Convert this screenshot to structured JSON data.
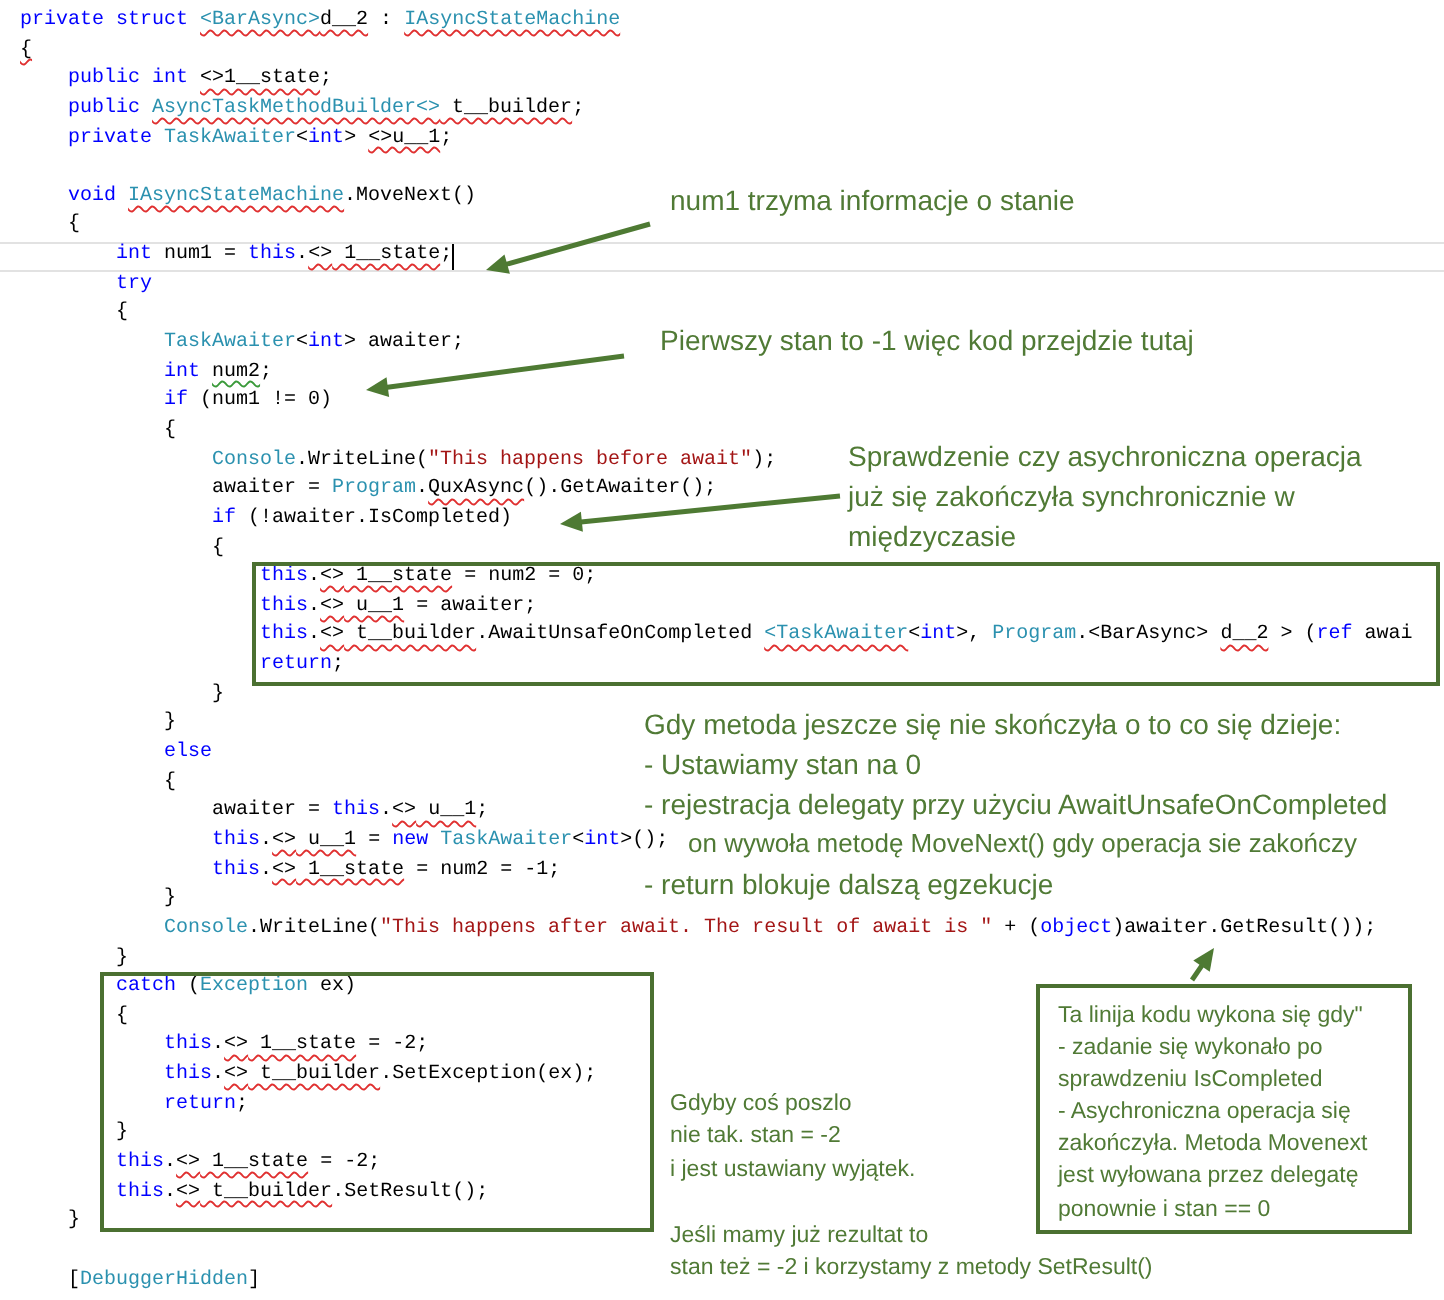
{
  "editor": {
    "lines": [
      {
        "current": false,
        "tokens": [
          {
            "text": "private struct ",
            "kind": "kw"
          },
          {
            "text": "<BarAsync>",
            "kind": "typeerr"
          },
          {
            "text": "d__2",
            "kind": "err"
          },
          {
            "text": " : ",
            "kind": "plain"
          },
          {
            "text": "IAsyncStateMachine",
            "kind": "typeerr"
          }
        ]
      },
      {
        "current": false,
        "tokens": [
          {
            "text": "{",
            "kind": "err"
          }
        ],
        "children": [
          {
            "current": false,
            "tokens": [
              {
                "text": "public int ",
                "kind": "kw"
              },
              {
                "text": "<>1__state",
                "kind": "err"
              },
              {
                "text": ";",
                "kind": "plain"
              }
            ]
          },
          {
            "current": false,
            "tokens": [
              {
                "text": "public ",
                "kind": "kw"
              },
              {
                "text": "AsyncTaskMethodBuilder<>",
                "kind": "typeerr"
              },
              {
                "text": " t__builder",
                "kind": "err"
              },
              {
                "text": ";",
                "kind": "plain"
              }
            ]
          },
          {
            "current": false,
            "tokens": [
              {
                "text": "private ",
                "kind": "kw"
              },
              {
                "text": "TaskAwaiter",
                "kind": "type"
              },
              {
                "text": "<",
                "kind": "plain"
              },
              {
                "text": "int",
                "kind": "kw"
              },
              {
                "text": "> ",
                "kind": "plain"
              },
              {
                "text": "<>u__1",
                "kind": "err"
              },
              {
                "text": ";",
                "kind": "plain"
              }
            ]
          },
          {
            "current": false
          },
          {
            "current": false,
            "tokens": [
              {
                "text": "void ",
                "kind": "kw"
              },
              {
                "text": "IAsyncStateMachine",
                "kind": "typeerr"
              },
              {
                "text": ".MoveNext()",
                "kind": "plain"
              }
            ]
          },
          {
            "current": false,
            "tokens": [
              {
                "text": "{",
                "kind": "plain"
              }
            ],
            "children": [
              {
                "current": true,
                "tokens": [
                  {
                    "text": "int ",
                    "kind": "kw"
                  },
                  {
                    "text": "num1 = ",
                    "kind": "plain"
                  },
                  {
                    "text": "this",
                    "kind": "kw"
                  },
                  {
                    "text": ".",
                    "kind": "plain"
                  },
                  {
                    "text": "<>",
                    "kind": "err"
                  },
                  {
                    "text": " 1__state",
                    "kind": "err"
                  },
                  {
                    "text": ";",
                    "kind": "plain"
                  }
                ]
              },
              {
                "current": false,
                "tokens": [
                  {
                    "text": "try",
                    "kind": "kw"
                  }
                ]
              },
              {
                "current": false,
                "tokens": [
                  {
                    "text": "{",
                    "kind": "plain"
                  }
                ],
                "children": [
                  {
                    "current": false,
                    "tokens": [
                      {
                        "text": "TaskAwaiter",
                        "kind": "type"
                      },
                      {
                        "text": "<",
                        "kind": "plain"
                      },
                      {
                        "text": "int",
                        "kind": "kw"
                      },
                      {
                        "text": "> awaiter;",
                        "kind": "plain"
                      }
                    ]
                  },
                  {
                    "current": false,
                    "tokens": [
                      {
                        "text": "int ",
                        "kind": "kw"
                      },
                      {
                        "text": "num2",
                        "kind": "warn"
                      },
                      {
                        "text": ";",
                        "kind": "plain"
                      }
                    ]
                  },
                  {
                    "current": false,
                    "tokens": [
                      {
                        "text": "if ",
                        "kind": "kw"
                      },
                      {
                        "text": "(num1 != 0)",
                        "kind": "plain"
                      }
                    ]
                  },
                  {
                    "current": false,
                    "tokens": [
                      {
                        "text": "{",
                        "kind": "plain"
                      }
                    ],
                    "children": [
                      {
                        "current": false,
                        "tokens": [
                          {
                            "text": "Console",
                            "kind": "type"
                          },
                          {
                            "text": ".WriteLine(",
                            "kind": "plain"
                          },
                          {
                            "text": "\"This happens before await\"",
                            "kind": "str"
                          },
                          {
                            "text": ");",
                            "kind": "plain"
                          }
                        ]
                      },
                      {
                        "current": false,
                        "tokens": [
                          {
                            "text": "awaiter = ",
                            "kind": "plain"
                          },
                          {
                            "text": "Program",
                            "kind": "type"
                          },
                          {
                            "text": ".",
                            "kind": "plain"
                          },
                          {
                            "text": "QuxAsync",
                            "kind": "err"
                          },
                          {
                            "text": "().GetAwaiter();",
                            "kind": "plain"
                          }
                        ]
                      },
                      {
                        "current": false,
                        "tokens": [
                          {
                            "text": "if ",
                            "kind": "kw"
                          },
                          {
                            "text": "(!awaiter.IsCompleted)",
                            "kind": "plain"
                          }
                        ]
                      },
                      {
                        "current": false,
                        "tokens": [
                          {
                            "text": "{",
                            "kind": "plain"
                          }
                        ],
                        "children": [
                          {
                            "current": false,
                            "tokens": [
                              {
                                "text": "this",
                                "kind": "kw"
                              },
                              {
                                "text": ".",
                                "kind": "plain"
                              },
                              {
                                "text": "<>",
                                "kind": "err"
                              },
                              {
                                "text": " 1__state",
                                "kind": "err"
                              },
                              {
                                "text": " = num2 = 0;",
                                "kind": "plain"
                              }
                            ]
                          },
                          {
                            "current": false,
                            "tokens": [
                              {
                                "text": "this",
                                "kind": "kw"
                              },
                              {
                                "text": ".",
                                "kind": "plain"
                              },
                              {
                                "text": "<>",
                                "kind": "err"
                              },
                              {
                                "text": " u__1",
                                "kind": "err"
                              },
                              {
                                "text": " = awaiter;",
                                "kind": "plain"
                              }
                            ]
                          },
                          {
                            "current": false,
                            "tokens": [
                              {
                                "text": "this",
                                "kind": "kw"
                              },
                              {
                                "text": ".",
                                "kind": "plain"
                              },
                              {
                                "text": "<>",
                                "kind": "err"
                              },
                              {
                                "text": " t__builder",
                                "kind": "err"
                              },
                              {
                                "text": ".AwaitUnsafeOnCompleted ",
                                "kind": "plain"
                              },
                              {
                                "text": "<TaskAwaiter",
                                "kind": "typeerr"
                              },
                              {
                                "text": "<",
                                "kind": "plain"
                              },
                              {
                                "text": "int",
                                "kind": "kw"
                              },
                              {
                                "text": ">, ",
                                "kind": "plain"
                              },
                              {
                                "text": "Program",
                                "kind": "type"
                              },
                              {
                                "text": ".<BarAsync> ",
                                "kind": "plain"
                              },
                              {
                                "text": "d__2",
                                "kind": "err"
                              },
                              {
                                "text": " > (",
                                "kind": "plain"
                              },
                              {
                                "text": "ref",
                                "kind": "kw"
                              },
                              {
                                "text": " awai",
                                "kind": "plain"
                              }
                            ]
                          },
                          {
                            "current": false,
                            "tokens": [
                              {
                                "text": "return",
                                "kind": "kw"
                              },
                              {
                                "text": ";",
                                "kind": "plain"
                              }
                            ]
                          }
                        ]
                      },
                      {
                        "current": false,
                        "tokens": [
                          {
                            "text": "}",
                            "kind": "plain"
                          }
                        ]
                      }
                    ]
                  },
                  {
                    "current": false,
                    "tokens": [
                      {
                        "text": "}",
                        "kind": "plain"
                      }
                    ]
                  },
                  {
                    "current": false,
                    "tokens": [
                      {
                        "text": "else",
                        "kind": "kw"
                      }
                    ]
                  },
                  {
                    "current": false,
                    "tokens": [
                      {
                        "text": "{",
                        "kind": "plain"
                      }
                    ],
                    "children": [
                      {
                        "current": false,
                        "tokens": [
                          {
                            "text": "awaiter = ",
                            "kind": "plain"
                          },
                          {
                            "text": "this",
                            "kind": "kw"
                          },
                          {
                            "text": ".",
                            "kind": "plain"
                          },
                          {
                            "text": "<>",
                            "kind": "err"
                          },
                          {
                            "text": " u__1",
                            "kind": "err"
                          },
                          {
                            "text": ";",
                            "kind": "plain"
                          }
                        ]
                      },
                      {
                        "current": false,
                        "tokens": [
                          {
                            "text": "this",
                            "kind": "kw"
                          },
                          {
                            "text": ".",
                            "kind": "plain"
                          },
                          {
                            "text": "<>",
                            "kind": "err"
                          },
                          {
                            "text": " u__1",
                            "kind": "err"
                          },
                          {
                            "text": " = ",
                            "kind": "plain"
                          },
                          {
                            "text": "new ",
                            "kind": "kw"
                          },
                          {
                            "text": "TaskAwaiter",
                            "kind": "type"
                          },
                          {
                            "text": "<",
                            "kind": "plain"
                          },
                          {
                            "text": "int",
                            "kind": "kw"
                          },
                          {
                            "text": ">();",
                            "kind": "plain"
                          }
                        ]
                      },
                      {
                        "current": false,
                        "tokens": [
                          {
                            "text": "this",
                            "kind": "kw"
                          },
                          {
                            "text": ".",
                            "kind": "plain"
                          },
                          {
                            "text": "<>",
                            "kind": "err"
                          },
                          {
                            "text": " 1__state",
                            "kind": "err"
                          },
                          {
                            "text": " = num2 = -1;",
                            "kind": "plain"
                          }
                        ]
                      }
                    ]
                  },
                  {
                    "current": false,
                    "tokens": [
                      {
                        "text": "}",
                        "kind": "plain"
                      }
                    ]
                  },
                  {
                    "current": false,
                    "tokens": [
                      {
                        "text": "Console",
                        "kind": "type"
                      },
                      {
                        "text": ".WriteLine(",
                        "kind": "plain"
                      },
                      {
                        "text": "\"This happens after await. The result of await is \"",
                        "kind": "str"
                      },
                      {
                        "text": " + (",
                        "kind": "plain"
                      },
                      {
                        "text": "object",
                        "kind": "kw"
                      },
                      {
                        "text": ")awaiter.GetResult());",
                        "kind": "plain"
                      }
                    ]
                  }
                ]
              },
              {
                "current": false,
                "tokens": [
                  {
                    "text": "}",
                    "kind": "plain"
                  }
                ]
              },
              {
                "current": false,
                "tokens": [
                  {
                    "text": "catch ",
                    "kind": "kw"
                  },
                  {
                    "text": "(",
                    "kind": "plain"
                  },
                  {
                    "text": "Exception",
                    "kind": "type"
                  },
                  {
                    "text": " ex)",
                    "kind": "plain"
                  }
                ]
              },
              {
                "current": false,
                "tokens": [
                  {
                    "text": "{",
                    "kind": "plain"
                  }
                ],
                "children": [
                  {
                    "current": false,
                    "tokens": [
                      {
                        "text": "this",
                        "kind": "kw"
                      },
                      {
                        "text": ".",
                        "kind": "plain"
                      },
                      {
                        "text": "<>",
                        "kind": "err"
                      },
                      {
                        "text": " 1__state",
                        "kind": "err"
                      },
                      {
                        "text": " = -2;",
                        "kind": "plain"
                      }
                    ]
                  },
                  {
                    "current": false,
                    "tokens": [
                      {
                        "text": "this",
                        "kind": "kw"
                      },
                      {
                        "text": ".",
                        "kind": "plain"
                      },
                      {
                        "text": "<>",
                        "kind": "err"
                      },
                      {
                        "text": " t__builder",
                        "kind": "err"
                      },
                      {
                        "text": ".SetException(ex);",
                        "kind": "plain"
                      }
                    ]
                  },
                  {
                    "current": false,
                    "tokens": [
                      {
                        "text": "return",
                        "kind": "kw"
                      },
                      {
                        "text": ";",
                        "kind": "plain"
                      }
                    ]
                  }
                ]
              },
              {
                "current": false,
                "tokens": [
                  {
                    "text": "}",
                    "kind": "plain"
                  }
                ]
              },
              {
                "current": false,
                "tokens": [
                  {
                    "text": "this",
                    "kind": "kw"
                  },
                  {
                    "text": ".",
                    "kind": "plain"
                  },
                  {
                    "text": "<>",
                    "kind": "err"
                  },
                  {
                    "text": " 1__state",
                    "kind": "err"
                  },
                  {
                    "text": " = -2;",
                    "kind": "plain"
                  }
                ]
              },
              {
                "current": false,
                "tokens": [
                  {
                    "text": "this",
                    "kind": "kw"
                  },
                  {
                    "text": ".",
                    "kind": "plain"
                  },
                  {
                    "text": "<>",
                    "kind": "err"
                  },
                  {
                    "text": " t__builder",
                    "kind": "err"
                  },
                  {
                    "text": ".SetResult();",
                    "kind": "plain"
                  }
                ]
              }
            ]
          },
          {
            "current": false,
            "tokens": [
              {
                "text": "}",
                "kind": "plain"
              }
            ]
          },
          {
            "current": false
          },
          {
            "current": false,
            "tokens": [
              {
                "text": "[",
                "kind": "plain"
              },
              {
                "text": "DebuggerHidden",
                "kind": "type"
              },
              {
                "text": "]",
                "kind": "plain"
              }
            ]
          }
        ]
      }
    ]
  },
  "notes": [
    {
      "kind": "large",
      "lines": [
        {
          "text": "num1 trzyma informacje o stanie",
          "kind": "line"
        }
      ]
    },
    {
      "kind": "large",
      "lines": [
        {
          "text": "Pierwszy stan to -1 więc kod przejdzie tutaj",
          "kind": "line"
        }
      ]
    },
    {
      "kind": "large",
      "lines": [
        {
          "text": "Sprawdzenie czy asychroniczna operacja",
          "kind": "line"
        },
        {
          "text": "już się zakończyła synchronicznie w",
          "kind": "line"
        },
        {
          "text": "międzyczasie",
          "kind": "line"
        }
      ]
    },
    {
      "kind": "large",
      "lines": [
        {
          "text": "Gdy metoda jeszcze się nie skończyła o to co się dzieje:",
          "kind": "line"
        },
        {
          "text": "- Ustawiamy stan na 0",
          "kind": "line"
        },
        {
          "text": "- rejestracja delegaty przy użyciu AwaitUnsafeOnCompleted",
          "kind": "line"
        },
        {
          "text": "on wywoła metodę MoveNext() gdy operacja sie zakończy",
          "kind": "wrap"
        },
        {
          "text": "- return blokuje dalszą egzekucje",
          "kind": "line"
        }
      ]
    },
    {
      "kind": "small",
      "lines": [
        {
          "text": "Gdyby coś poszlo",
          "kind": "line"
        },
        {
          "text": "nie tak. stan = -2",
          "kind": "line"
        },
        {
          "text": "i jest ustawiany wyjątek.",
          "kind": "line"
        }
      ]
    },
    {
      "kind": "small",
      "lines": [
        {
          "text": "Jeśli mamy już rezultat to",
          "kind": "line"
        },
        {
          "text": "stan też = -2 i korzystamy z metody SetResult()",
          "kind": "line"
        }
      ]
    },
    {
      "kind": "boxed",
      "lines": [
        {
          "text": "Ta linija kodu wykona się gdy\"",
          "kind": "line"
        },
        {
          "text": "- zadanie się wykonało po",
          "kind": "line"
        },
        {
          "text": "sprawdzeniu IsCompleted",
          "kind": "line"
        },
        {
          "text": "- Asychroniczna operacja się",
          "kind": "line"
        },
        {
          "text": "zakończyła. Metoda Movenext",
          "kind": "line"
        },
        {
          "text": "jest wyłowana przez delegatę",
          "kind": "line"
        },
        {
          "text": "ponownie i stan == 0",
          "kind": "line"
        }
      ]
    }
  ]
}
